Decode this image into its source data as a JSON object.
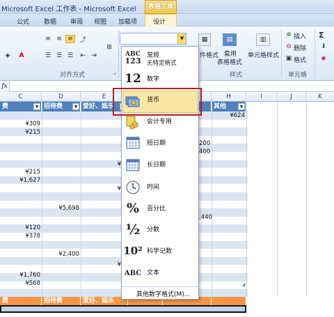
{
  "window": {
    "title": "Microsoft Excel 工作表 - Microsoft Excel",
    "context_tab_group": "表格工具"
  },
  "tabs": [
    "公式",
    "数据",
    "审阅",
    "视图",
    "加载项",
    "设计"
  ],
  "ribbon": {
    "group_alignment": "对齐方式",
    "group_styles": "样式",
    "group_cells": "单元格",
    "cond_format_short": "件格式",
    "table_format": [
      "套用",
      "表格格式"
    ],
    "cell_styles": "单元格样式",
    "insert": "插入",
    "delete": "删除",
    "format": "格式",
    "sum_icon": "Σ"
  },
  "formula_bar": {
    "fx": "fx"
  },
  "columns": [
    "C",
    "D",
    "E",
    "F",
    "G",
    "H",
    "I",
    "J",
    "K"
  ],
  "table_headers": [
    "费",
    "招待费",
    "爱好、娱乐",
    "",
    "",
    "其他"
  ],
  "table_footer_headers": [
    "费",
    "招待费",
    "爱好、娱乐",
    "",
    "",
    ""
  ],
  "cells": {
    "h1": "¥624",
    "c2": "¥309",
    "c3": "¥215",
    "g4": "200",
    "g5": "400",
    "e6": "¥",
    "c8": "¥215",
    "c9": "¥1,627",
    "e10": "¥",
    "d12": "¥5,698",
    "g13": ",440",
    "c14": "¥120",
    "c15": "¥378",
    "d17": "¥2,400",
    "e18": "¥",
    "c19": "¥1,760",
    "c20": "¥568"
  },
  "number_format_menu": {
    "items": [
      {
        "label": "常规",
        "sub": "无特定格式",
        "icon": "abc-123-icon",
        "icon_text": [
          "ABC",
          "123"
        ]
      },
      {
        "label": "数字",
        "icon": "number-12-icon",
        "icon_text": "12"
      },
      {
        "label": "货币",
        "icon": "currency-icon"
      },
      {
        "label": "会计专用",
        "icon": "accounting-icon"
      },
      {
        "label": "短日期",
        "icon": "calendar-short-icon"
      },
      {
        "label": "长日期",
        "icon": "calendar-long-icon"
      },
      {
        "label": "时间",
        "icon": "clock-icon"
      },
      {
        "label": "百分比",
        "icon": "percent-icon",
        "icon_text": "%"
      },
      {
        "label": "分数",
        "icon": "fraction-icon",
        "icon_text": "½"
      },
      {
        "label": "科学记数",
        "icon": "scientific-icon",
        "icon_text": "10²"
      },
      {
        "label": "文本",
        "icon": "text-abc-icon",
        "icon_text": "ABC"
      }
    ],
    "footer": "其他数字格式(M)...",
    "highlighted_index": 2,
    "highlight_color": "#c0181f"
  }
}
